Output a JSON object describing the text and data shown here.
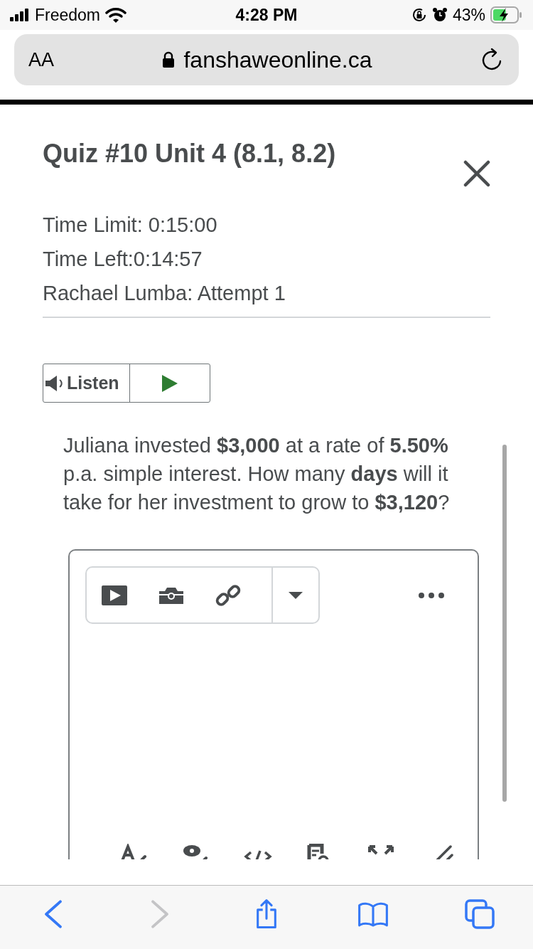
{
  "status_bar": {
    "carrier": "Freedom",
    "time": "4:28 PM",
    "battery": "43%",
    "charging": true
  },
  "address_bar": {
    "text_size": "AA",
    "url": "fanshaweonline.ca"
  },
  "quiz": {
    "title": "Quiz #10 Unit 4 (8.1, 8.2)",
    "info": [
      "Time Limit: 0:15:00",
      "Time Left:0:14:57",
      "Rachael Lumba: Attempt 1"
    ],
    "listen_label": "Listen",
    "question": "Juliana invested **$3,000** at a rate of **5.50%** p.a. simple interest. How many **days** will it take for her investment to grow to **$3,120**?"
  },
  "browser_toolbar": [
    {
      "kind": "back",
      "disabled": false
    },
    {
      "kind": "forward",
      "disabled": true
    },
    {
      "kind": "share",
      "disabled": false
    },
    {
      "kind": "bookmarks",
      "disabled": false
    },
    {
      "kind": "tabs",
      "disabled": false
    }
  ]
}
